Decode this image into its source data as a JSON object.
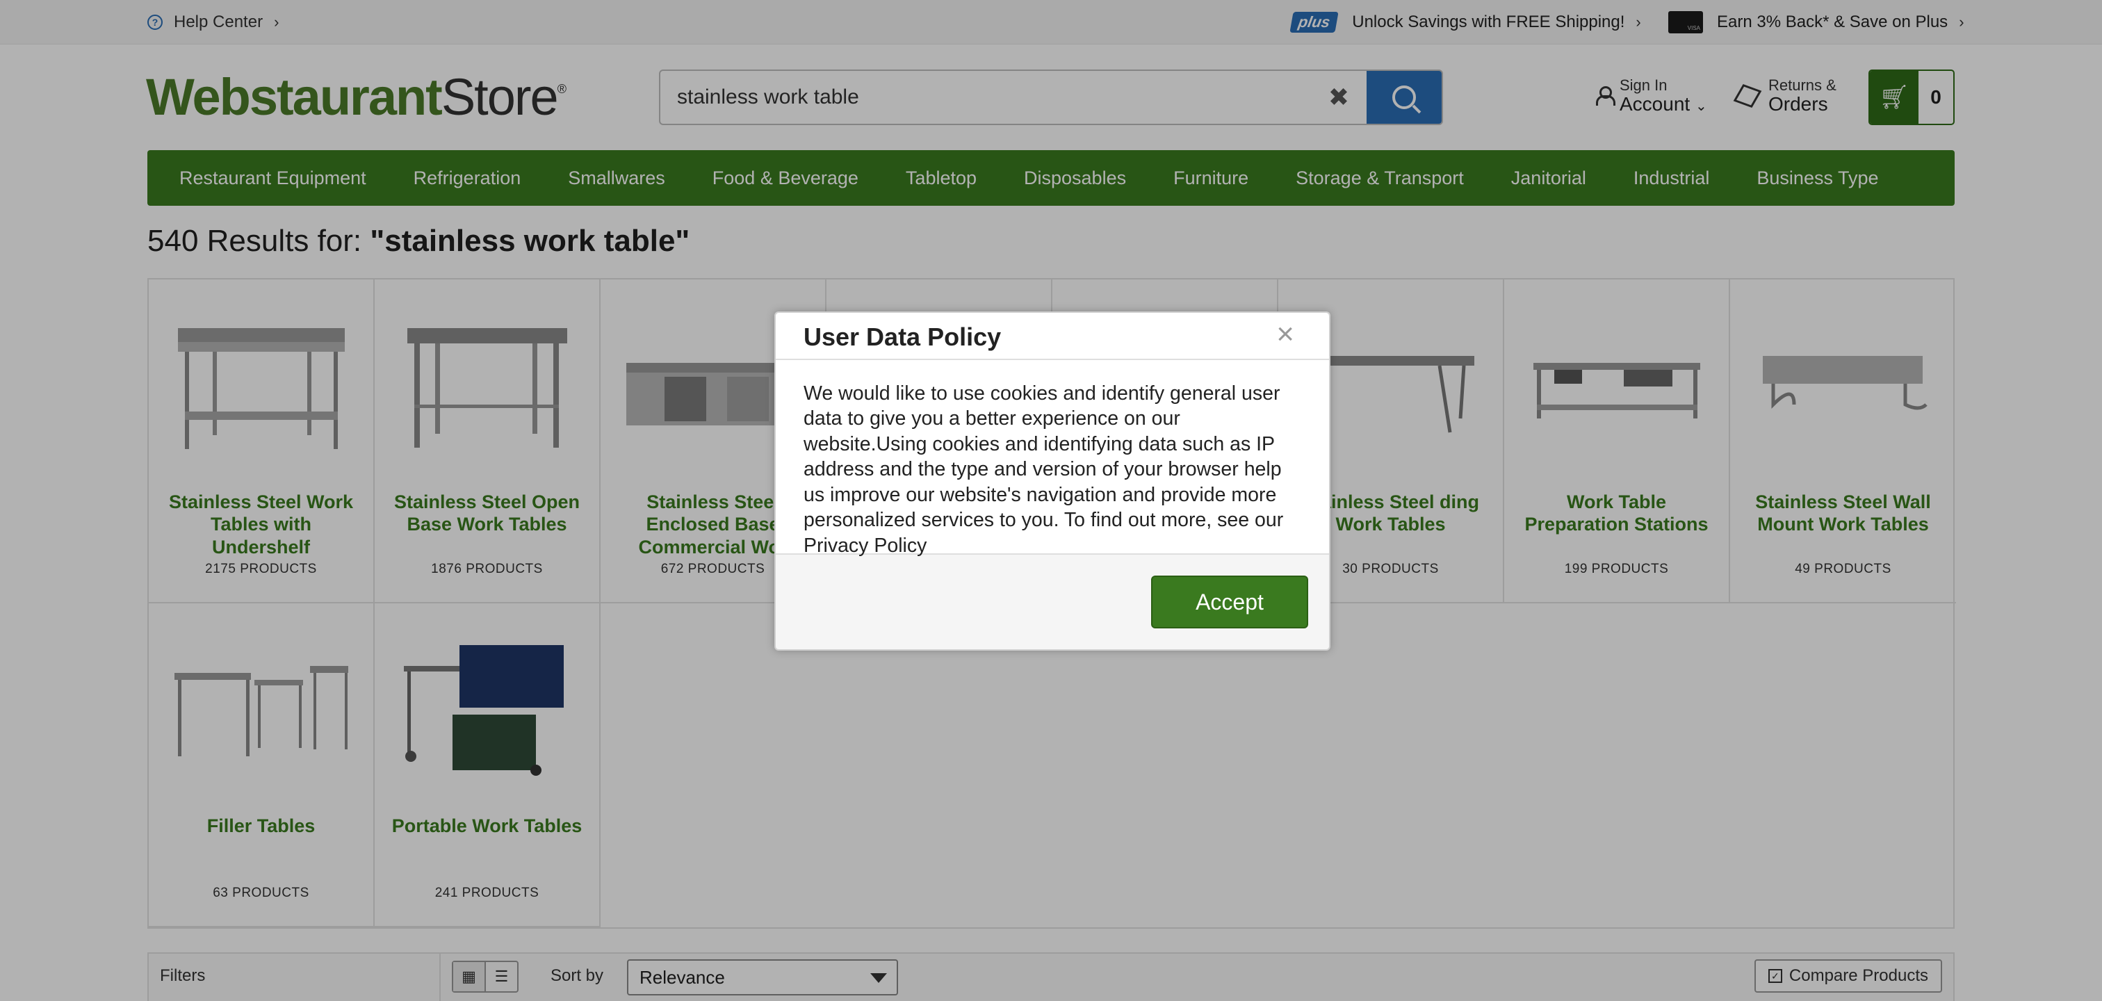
{
  "topbar": {
    "help_center": "Help Center",
    "plus_badge": "plus",
    "promo_shipping": "Unlock Savings with FREE Shipping!",
    "promo_card": "Earn 3% Back* & Save on Plus"
  },
  "header": {
    "logo_bold": "Webstaurant",
    "logo_light": "Store",
    "logo_reg": "®",
    "search_value": "stainless work table",
    "account_small": "Sign In",
    "account_big": "Account",
    "returns_small": "Returns &",
    "returns_big": "Orders",
    "cart_count": "0"
  },
  "nav": [
    "Restaurant Equipment",
    "Refrigeration",
    "Smallwares",
    "Food & Beverage",
    "Tabletop",
    "Disposables",
    "Furniture",
    "Storage & Transport",
    "Janitorial",
    "Industrial",
    "Business Type"
  ],
  "results": {
    "title_prefix": "540 Results for: ",
    "query": "\"stainless work table\""
  },
  "categories": [
    {
      "name": "Stainless Steel Work Tables with Undershelf",
      "count": "2175 PRODUCTS"
    },
    {
      "name": "Stainless Steel Open Base Work Tables",
      "count": "1876 PRODUCTS"
    },
    {
      "name": "Stainless Steel Enclosed Base Commercial Wor",
      "count": "672 PRODUCTS"
    },
    {
      "name": "",
      "count": ""
    },
    {
      "name": "",
      "count": ""
    },
    {
      "name": "Stainless Steel ding Work Tables",
      "count": "30 PRODUCTS"
    },
    {
      "name": "Work Table Preparation Stations",
      "count": "199 PRODUCTS"
    },
    {
      "name": "Stainless Steel Wall Mount Work Tables",
      "count": "49 PRODUCTS"
    },
    {
      "name": "Filler Tables",
      "count": "63 PRODUCTS"
    },
    {
      "name": "Portable Work Tables",
      "count": "241 PRODUCTS"
    }
  ],
  "toolbar": {
    "filters": "Filters",
    "sort_label": "Sort by",
    "sort_value": "Relevance",
    "compare": "Compare Products"
  },
  "modal": {
    "title": "User Data Policy",
    "close": "×",
    "body": "We would like to use cookies and identify general user data to give you a better experience on our website.Using cookies and identifying data such as IP address and the type and version of your browser help us improve our website's navigation and provide more personalized services to you. To find out more, see our Privacy Policy",
    "accept": "Accept"
  },
  "colors": {
    "brand_green": "#3a7a1f",
    "brand_blue": "#2a6db5",
    "overlay": "rgba(0,0,0,0.3)"
  }
}
